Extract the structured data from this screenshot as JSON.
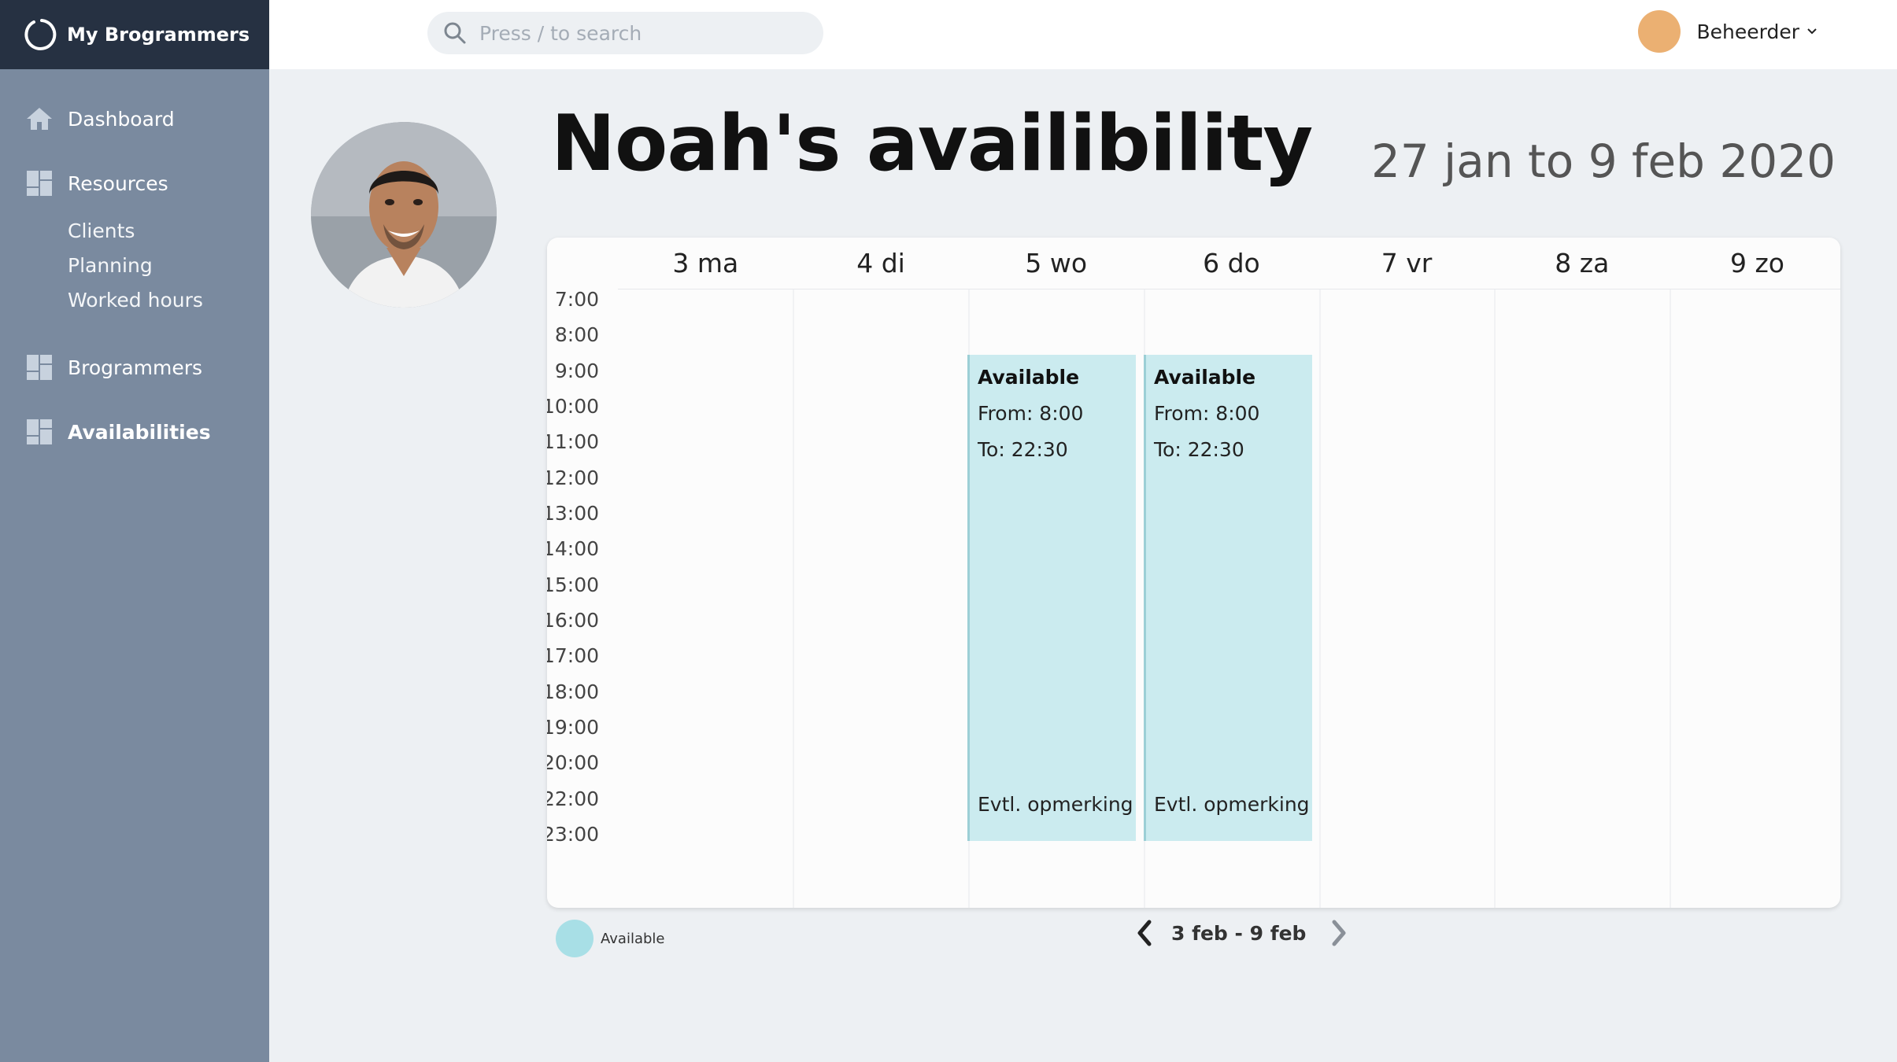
{
  "sidebar": {
    "brand": "My Brogrammers",
    "nav": [
      {
        "label": "Dashboard",
        "icon": "home-icon"
      },
      {
        "label": "Resources",
        "icon": "grid-icon"
      },
      {
        "label": "Brogrammers",
        "icon": "grid-icon"
      },
      {
        "label": "Availabilities",
        "icon": "grid-icon",
        "active": true
      }
    ],
    "subnav": [
      "Clients",
      "Planning",
      "Worked hours"
    ]
  },
  "topbar": {
    "search_placeholder": "Press / to search",
    "user_name": "Beheerder"
  },
  "header": {
    "title": "Noah's availibility",
    "date_range": "27 jan to 9 feb 2020"
  },
  "calendar": {
    "days": [
      "3 ma",
      "4 di",
      "5 wo",
      "6 do",
      "7 vr",
      "8 za",
      "9 zo"
    ],
    "times": [
      "7:00",
      "8:00",
      "9:00",
      "10:00",
      "11:00",
      "12:00",
      "13:00",
      "14:00",
      "15:00",
      "16:00",
      "17:00",
      "18:00",
      "19:00",
      "20:00",
      "22:00",
      "23:00"
    ],
    "events": [
      {
        "day": "5 wo",
        "title": "Available",
        "from": "From: 8:00",
        "to": "To: 22:30",
        "note": "Evtl. opmerking"
      },
      {
        "day": "6 do",
        "title": "Available",
        "from": "From: 8:00",
        "to": "To: 22:30",
        "note": "Evtl. opmerking"
      }
    ]
  },
  "legend": {
    "label": "Available",
    "color": "#a8dfe6"
  },
  "pager": {
    "label": "3 feb - 9 feb"
  },
  "colors": {
    "sidebar": "#7a8a9f",
    "brand_bar": "#263142",
    "accent_event": "#cbebef",
    "avatar": "#ebb072"
  }
}
